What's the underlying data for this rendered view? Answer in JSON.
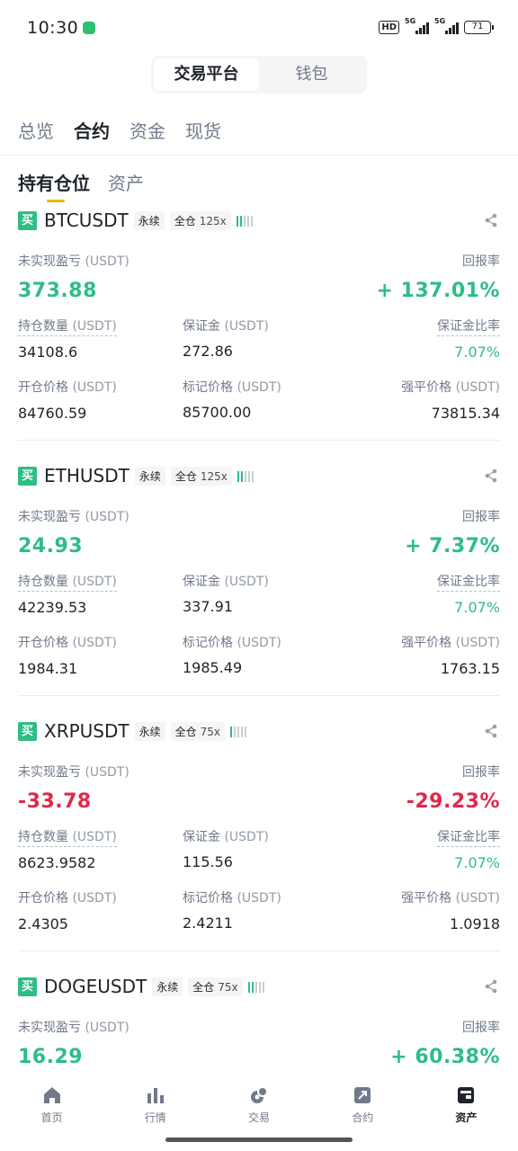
{
  "status_bar": {
    "time": "10:30",
    "hd": "HD",
    "sig1": "5G",
    "sig2": "5G",
    "battery": "71"
  },
  "segment": {
    "options": [
      "交易平台",
      "钱包"
    ],
    "active": 0
  },
  "top_tabs": [
    "总览",
    "合约",
    "资金",
    "现货"
  ],
  "top_tab_active": 1,
  "sub_tabs": [
    "持有仓位",
    "资产"
  ],
  "sub_tab_active": 0,
  "labels": {
    "unrealized_pnl": "未实现盈亏",
    "roe": "回报率",
    "position_size": "持仓数量",
    "margin": "保证金",
    "margin_ratio": "保证金比率",
    "entry_price": "开仓价格",
    "mark_price": "标记价格",
    "liq_price": "强平价格",
    "unit": "(USDT)",
    "perpetual": "永续",
    "cross": "全仓",
    "buy": "买"
  },
  "positions": [
    {
      "symbol": "BTCUSDT",
      "leverage": "125x",
      "risk_level": 1,
      "pnl": "373.88",
      "pnl_dir": "up",
      "roe": "+ 137.01%",
      "size": "34108.6",
      "margin": "272.86",
      "margin_ratio": "7.07%",
      "entry": "84760.59",
      "mark": "85700.00",
      "liq": "73815.34"
    },
    {
      "symbol": "ETHUSDT",
      "leverage": "125x",
      "risk_level": 1,
      "pnl": "24.93",
      "pnl_dir": "up",
      "roe": "+ 7.37%",
      "size": "42239.53",
      "margin": "337.91",
      "margin_ratio": "7.07%",
      "entry": "1984.31",
      "mark": "1985.49",
      "liq": "1763.15"
    },
    {
      "symbol": "XRPUSDT",
      "leverage": "75x",
      "risk_level": 1,
      "pnl": "-33.78",
      "pnl_dir": "down",
      "roe": "-29.23%",
      "size": "8623.9582",
      "margin": "115.56",
      "margin_ratio": "7.07%",
      "entry": "2.4305",
      "mark": "2.4211",
      "liq": "1.0918"
    },
    {
      "symbol": "DOGEUSDT",
      "leverage": "75x",
      "risk_level": 1,
      "pnl": "16.29",
      "pnl_dir": "up",
      "roe": "+ 60.38%"
    }
  ],
  "colors": {
    "up": "#2ebd85",
    "down": "#e0294a",
    "accent": "#f0b90b"
  },
  "bottom_nav": [
    {
      "label": "首页",
      "icon": "home-icon"
    },
    {
      "label": "行情",
      "icon": "markets-icon"
    },
    {
      "label": "交易",
      "icon": "trade-icon"
    },
    {
      "label": "合约",
      "icon": "futures-icon"
    },
    {
      "label": "资产",
      "icon": "wallet-icon"
    }
  ],
  "bottom_nav_active": 4
}
